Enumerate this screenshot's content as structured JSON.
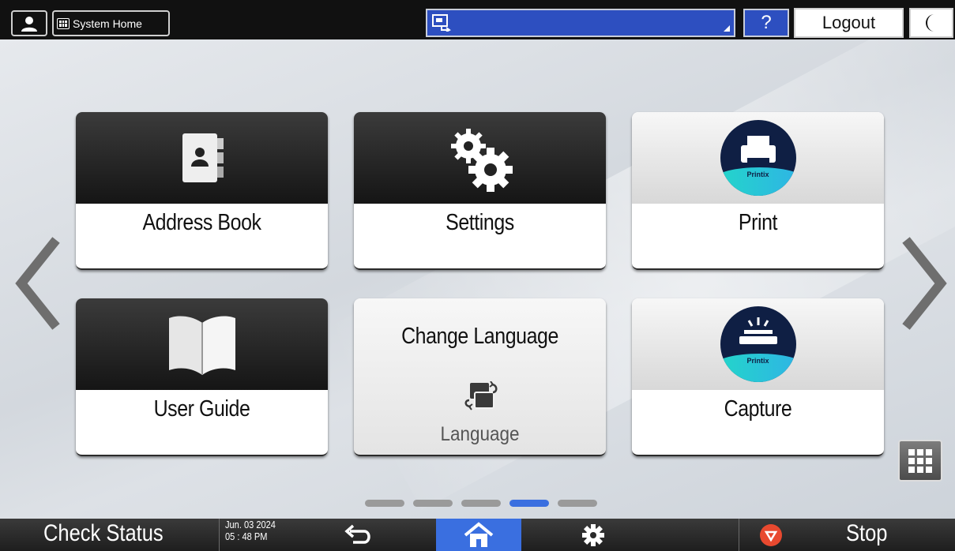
{
  "topbar": {
    "system_home_label": "System Home",
    "help_label": "?",
    "logout_label": "Logout"
  },
  "tiles": [
    {
      "label": "Address Book",
      "icon": "address-book-icon"
    },
    {
      "label": "Settings",
      "icon": "gears-icon"
    },
    {
      "label": "Print",
      "icon": "printix-print-icon",
      "badge": "Printix"
    },
    {
      "label": "User Guide",
      "icon": "book-icon"
    },
    {
      "title": "Change Language",
      "sub": "Language",
      "icon": "change-language-icon"
    },
    {
      "label": "Capture",
      "icon": "printix-capture-icon",
      "badge": "Printix"
    }
  ],
  "pager": {
    "count": 5,
    "active_index": 3
  },
  "bottombar": {
    "check_status_label": "Check Status",
    "date": "Jun. 03 2024",
    "time": "05 : 48 PM",
    "stop_label": "Stop"
  },
  "colors": {
    "accent": "#3a6fe0",
    "status_field": "#2d4fc0",
    "stop": "#e8492f"
  }
}
